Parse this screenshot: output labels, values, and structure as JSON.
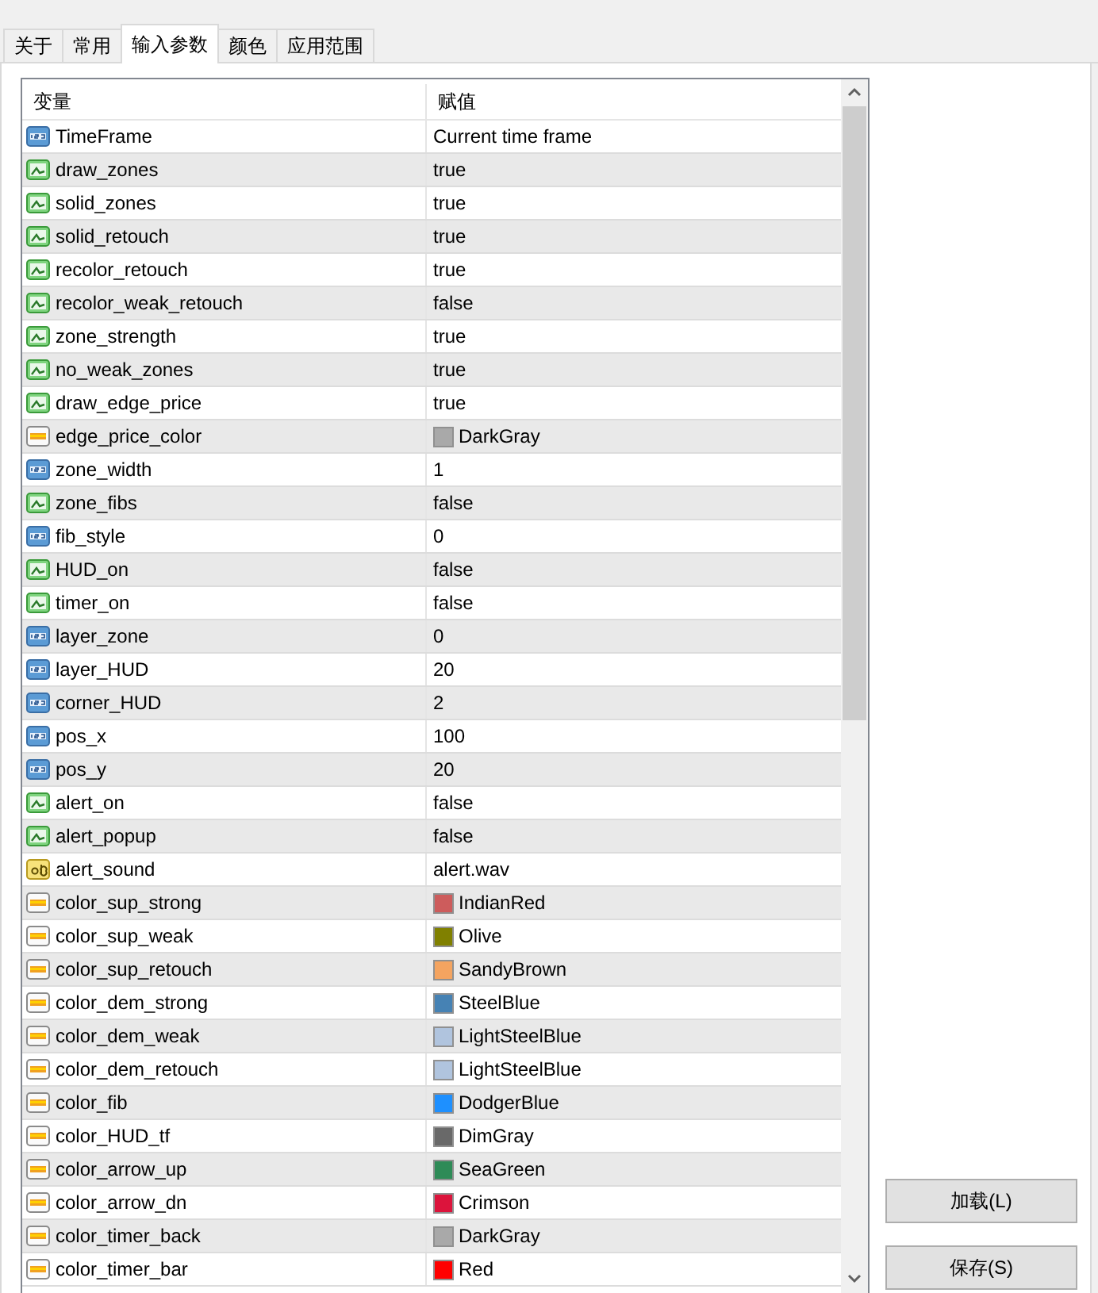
{
  "tabs": [
    {
      "label": "关于",
      "selected": false
    },
    {
      "label": "常用",
      "selected": false
    },
    {
      "label": "输入参数",
      "selected": true
    },
    {
      "label": "颜色",
      "selected": false
    },
    {
      "label": "应用范围",
      "selected": false
    }
  ],
  "table": {
    "columns": [
      "变量",
      "赋值"
    ],
    "rows": [
      {
        "kind": "int",
        "name": "TimeFrame",
        "value": "Current time frame"
      },
      {
        "kind": "bool",
        "name": "draw_zones",
        "value": "true"
      },
      {
        "kind": "bool",
        "name": "solid_zones",
        "value": "true"
      },
      {
        "kind": "bool",
        "name": "solid_retouch",
        "value": "true"
      },
      {
        "kind": "bool",
        "name": "recolor_retouch",
        "value": "true"
      },
      {
        "kind": "bool",
        "name": "recolor_weak_retouch",
        "value": "false"
      },
      {
        "kind": "bool",
        "name": "zone_strength",
        "value": "true"
      },
      {
        "kind": "bool",
        "name": "no_weak_zones",
        "value": "true"
      },
      {
        "kind": "bool",
        "name": "draw_edge_price",
        "value": "true"
      },
      {
        "kind": "color",
        "name": "edge_price_color",
        "value": "DarkGray",
        "color": "#a9a9a9"
      },
      {
        "kind": "int",
        "name": "zone_width",
        "value": "1"
      },
      {
        "kind": "bool",
        "name": "zone_fibs",
        "value": "false"
      },
      {
        "kind": "int",
        "name": "fib_style",
        "value": "0"
      },
      {
        "kind": "bool",
        "name": "HUD_on",
        "value": "false"
      },
      {
        "kind": "bool",
        "name": "timer_on",
        "value": "false"
      },
      {
        "kind": "int",
        "name": "layer_zone",
        "value": "0"
      },
      {
        "kind": "int",
        "name": "layer_HUD",
        "value": "20"
      },
      {
        "kind": "int",
        "name": "corner_HUD",
        "value": "2"
      },
      {
        "kind": "int",
        "name": "pos_x",
        "value": "100"
      },
      {
        "kind": "int",
        "name": "pos_y",
        "value": "20"
      },
      {
        "kind": "bool",
        "name": "alert_on",
        "value": "false"
      },
      {
        "kind": "bool",
        "name": "alert_popup",
        "value": "false"
      },
      {
        "kind": "string",
        "name": "alert_sound",
        "value": "alert.wav"
      },
      {
        "kind": "color",
        "name": "color_sup_strong",
        "value": "IndianRed",
        "color": "#cd5c5c"
      },
      {
        "kind": "color",
        "name": "color_sup_weak",
        "value": "Olive",
        "color": "#808000"
      },
      {
        "kind": "color",
        "name": "color_sup_retouch",
        "value": "SandyBrown",
        "color": "#f4a460"
      },
      {
        "kind": "color",
        "name": "color_dem_strong",
        "value": "SteelBlue",
        "color": "#4682b4"
      },
      {
        "kind": "color",
        "name": "color_dem_weak",
        "value": "LightSteelBlue",
        "color": "#b0c4de"
      },
      {
        "kind": "color",
        "name": "color_dem_retouch",
        "value": "LightSteelBlue",
        "color": "#b0c4de"
      },
      {
        "kind": "color",
        "name": "color_fib",
        "value": "DodgerBlue",
        "color": "#1e90ff"
      },
      {
        "kind": "color",
        "name": "color_HUD_tf",
        "value": "DimGray",
        "color": "#696969"
      },
      {
        "kind": "color",
        "name": "color_arrow_up",
        "value": "SeaGreen",
        "color": "#2e8b57"
      },
      {
        "kind": "color",
        "name": "color_arrow_dn",
        "value": "Crimson",
        "color": "#dc143c"
      },
      {
        "kind": "color",
        "name": "color_timer_back",
        "value": "DarkGray",
        "color": "#a9a9a9"
      },
      {
        "kind": "color",
        "name": "color_timer_bar",
        "value": "Red",
        "color": "#ff0000"
      }
    ]
  },
  "buttons": [
    "加载(L)",
    "保存(S)"
  ]
}
